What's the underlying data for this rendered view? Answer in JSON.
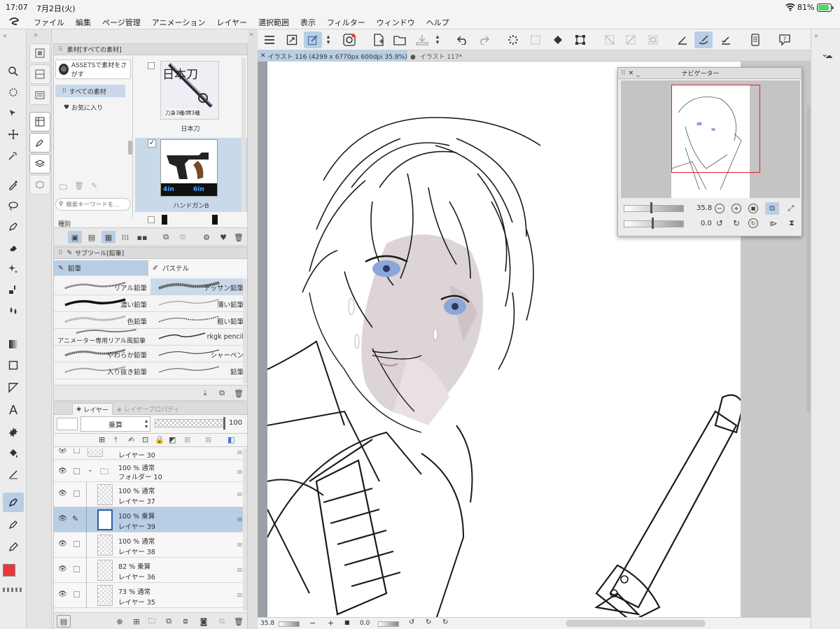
{
  "status": {
    "time": "17:07",
    "date": "7月2日(火)",
    "battery": "81%"
  },
  "menu": [
    "ファイル",
    "編集",
    "ページ管理",
    "アニメーション",
    "レイヤー",
    "選択範囲",
    "表示",
    "フィルター",
    "ウィンドウ",
    "ヘルプ"
  ],
  "material": {
    "title": "素材[すべての素材]",
    "assets_label": "ASSETSで素材をさがす",
    "tree": [
      "すべての素材",
      "お気に入り"
    ],
    "search_placeholder": "検索キーワードを…",
    "kind_label": "種別",
    "items": [
      {
        "name": "日本刀",
        "thumb_title": "日本刀",
        "thumb_sub": "刀身3種/鍔3種"
      },
      {
        "name": "ハンドガンB",
        "badges": [
          "4in",
          "6in"
        ]
      }
    ]
  },
  "subtool": {
    "title": "サブツール[鉛筆]",
    "tabs": [
      "鉛筆",
      "パステル"
    ],
    "brushes": [
      [
        "リアル鉛筆",
        "デッサン鉛筆"
      ],
      [
        "濃い鉛筆",
        "薄い鉛筆"
      ],
      [
        "色鉛筆",
        "粗い鉛筆"
      ],
      [
        "アニメーター専用リアル風鉛筆",
        "rkgk pencil"
      ],
      [
        "やわらか鉛筆",
        "シャーペン"
      ],
      [
        "入り抜き鉛筆",
        "鉛筆"
      ]
    ]
  },
  "layer": {
    "tabs": [
      "レイヤー",
      "レイヤープロパティ"
    ],
    "blend_mode": "乗算",
    "opacity": "100",
    "rows": [
      {
        "mode": "",
        "name": "レイヤー 30",
        "level": 0
      },
      {
        "mode": "100 % 通常",
        "name": "フォルダー 10",
        "level": 0,
        "folder": true
      },
      {
        "mode": "100 % 通常",
        "name": "レイヤー 37",
        "level": 1
      },
      {
        "mode": "100 % 乗算",
        "name": "レイヤー 39",
        "level": 1,
        "selected": true
      },
      {
        "mode": "100 % 通常",
        "name": "レイヤー 38",
        "level": 1
      },
      {
        "mode": "82 % 乗算",
        "name": "レイヤー 36",
        "level": 1
      },
      {
        "mode": "73 % 通常",
        "name": "レイヤー 35",
        "level": 1
      }
    ]
  },
  "canvas": {
    "tabs": [
      "イラスト 116 (4299 x 6770px 600dpi 35.8%)",
      "イラスト 117*"
    ],
    "zoom": "35.8",
    "rotation": "0.0"
  },
  "navigator": {
    "title": "ナビゲーター",
    "zoom": "35.8",
    "rotation": "0.0"
  },
  "colors": {
    "main": "#e8383d",
    "sub": "#5b7fc8",
    "accent": "#b8cee4"
  }
}
